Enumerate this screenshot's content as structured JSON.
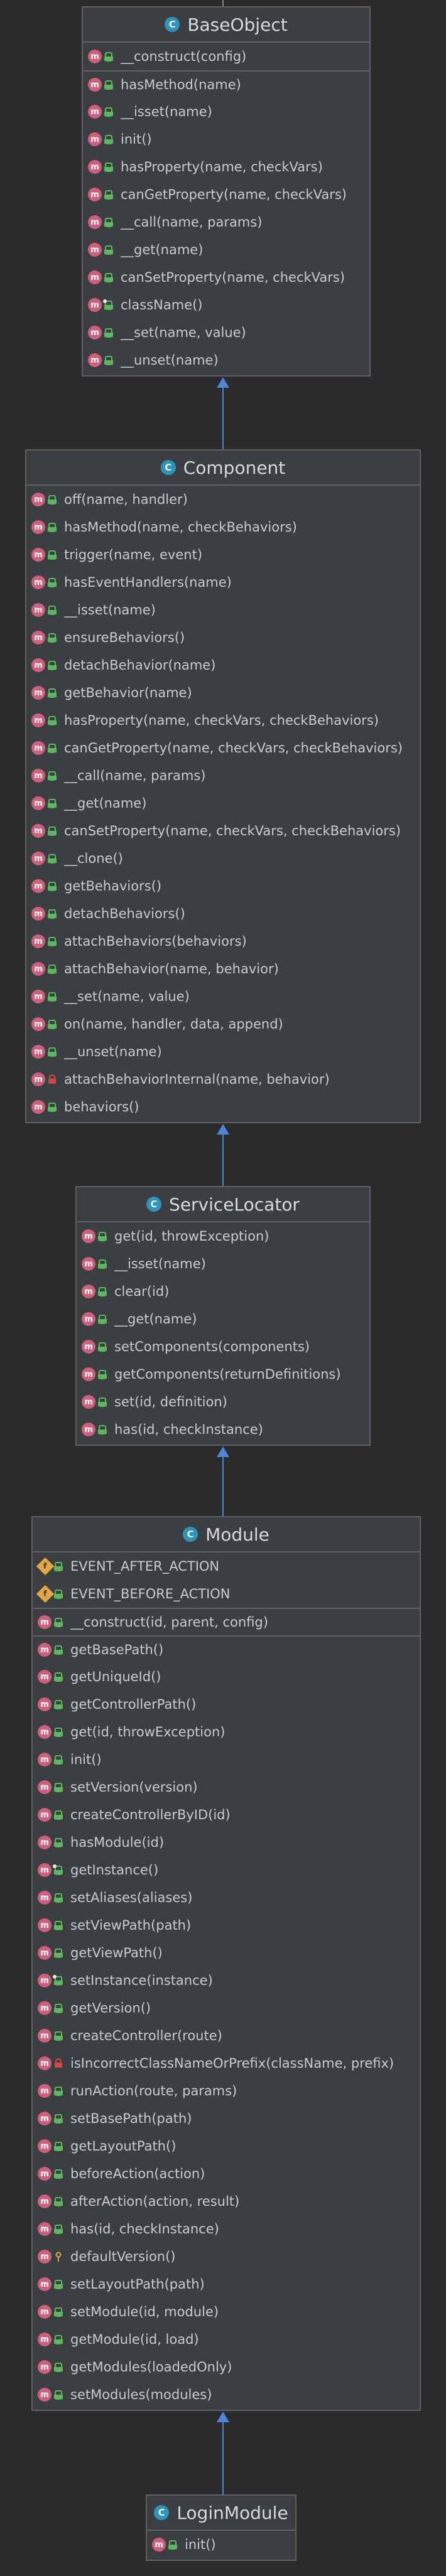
{
  "colors": {
    "background": "#2b2b2b",
    "box": "#3c3f41",
    "border": "#5e6163",
    "class_icon": "#2f94b8",
    "method_icon": "#d05f7b",
    "field_icon": "#e3a644",
    "public": "#5bb85d",
    "protected": "#e0a23e",
    "private": "#d04848",
    "arrow": "#4d86d6"
  },
  "icons": {
    "class": "C",
    "method": "m",
    "field": "f"
  },
  "classes": [
    {
      "name": "BaseObject",
      "rows": [
        {
          "kind": "method",
          "vis": "public",
          "label": "__construct(config)"
        },
        {
          "sep": true,
          "kind": "method",
          "vis": "public",
          "label": "hasMethod(name)"
        },
        {
          "kind": "method",
          "vis": "public",
          "label": "__isset(name)"
        },
        {
          "kind": "method",
          "vis": "public",
          "label": "init()"
        },
        {
          "kind": "method",
          "vis": "public",
          "label": "hasProperty(name, checkVars)"
        },
        {
          "kind": "method",
          "vis": "public",
          "label": "canGetProperty(name, checkVars)"
        },
        {
          "kind": "method",
          "vis": "public",
          "label": "__call(name, params)"
        },
        {
          "kind": "method",
          "vis": "public",
          "label": "__get(name)"
        },
        {
          "kind": "method",
          "vis": "public",
          "label": "canSetProperty(name, checkVars)"
        },
        {
          "kind": "method",
          "vis": "public",
          "static": true,
          "label": "className()"
        },
        {
          "kind": "method",
          "vis": "public",
          "label": "__set(name, value)"
        },
        {
          "kind": "method",
          "vis": "public",
          "label": "__unset(name)"
        }
      ]
    },
    {
      "name": "Component",
      "rows": [
        {
          "kind": "method",
          "vis": "public",
          "label": "off(name, handler)"
        },
        {
          "kind": "method",
          "vis": "public",
          "label": "hasMethod(name, checkBehaviors)"
        },
        {
          "kind": "method",
          "vis": "public",
          "label": "trigger(name, event)"
        },
        {
          "kind": "method",
          "vis": "public",
          "label": "hasEventHandlers(name)"
        },
        {
          "kind": "method",
          "vis": "public",
          "label": "__isset(name)"
        },
        {
          "kind": "method",
          "vis": "public",
          "label": "ensureBehaviors()"
        },
        {
          "kind": "method",
          "vis": "public",
          "label": "detachBehavior(name)"
        },
        {
          "kind": "method",
          "vis": "public",
          "label": "getBehavior(name)"
        },
        {
          "kind": "method",
          "vis": "public",
          "label": "hasProperty(name, checkVars, checkBehaviors)"
        },
        {
          "kind": "method",
          "vis": "public",
          "label": "canGetProperty(name, checkVars, checkBehaviors)"
        },
        {
          "kind": "method",
          "vis": "public",
          "label": "__call(name, params)"
        },
        {
          "kind": "method",
          "vis": "public",
          "label": "__get(name)"
        },
        {
          "kind": "method",
          "vis": "public",
          "label": "canSetProperty(name, checkVars, checkBehaviors)"
        },
        {
          "kind": "method",
          "vis": "public",
          "label": "__clone()"
        },
        {
          "kind": "method",
          "vis": "public",
          "label": "getBehaviors()"
        },
        {
          "kind": "method",
          "vis": "public",
          "label": "detachBehaviors()"
        },
        {
          "kind": "method",
          "vis": "public",
          "label": "attachBehaviors(behaviors)"
        },
        {
          "kind": "method",
          "vis": "public",
          "label": "attachBehavior(name, behavior)"
        },
        {
          "kind": "method",
          "vis": "public",
          "label": "__set(name, value)"
        },
        {
          "kind": "method",
          "vis": "public",
          "label": "on(name, handler, data, append)"
        },
        {
          "kind": "method",
          "vis": "public",
          "label": "__unset(name)"
        },
        {
          "kind": "method",
          "vis": "private",
          "label": "attachBehaviorInternal(name, behavior)"
        },
        {
          "kind": "method",
          "vis": "public",
          "label": "behaviors()"
        }
      ]
    },
    {
      "name": "ServiceLocator",
      "rows": [
        {
          "kind": "method",
          "vis": "public",
          "label": "get(id, throwException)"
        },
        {
          "kind": "method",
          "vis": "public",
          "label": "__isset(name)"
        },
        {
          "kind": "method",
          "vis": "public",
          "label": "clear(id)"
        },
        {
          "kind": "method",
          "vis": "public",
          "label": "__get(name)"
        },
        {
          "kind": "method",
          "vis": "public",
          "label": "setComponents(components)"
        },
        {
          "kind": "method",
          "vis": "public",
          "label": "getComponents(returnDefinitions)"
        },
        {
          "kind": "method",
          "vis": "public",
          "label": "set(id, definition)"
        },
        {
          "kind": "method",
          "vis": "public",
          "label": "has(id, checkInstance)"
        }
      ]
    },
    {
      "name": "Module",
      "rows": [
        {
          "kind": "field",
          "vis": "public",
          "label": "EVENT_AFTER_ACTION"
        },
        {
          "kind": "field",
          "vis": "public",
          "label": "EVENT_BEFORE_ACTION"
        },
        {
          "sep": true,
          "kind": "method",
          "vis": "public",
          "label": "__construct(id, parent, config)"
        },
        {
          "sep": true,
          "kind": "method",
          "vis": "public",
          "label": "getBasePath()"
        },
        {
          "kind": "method",
          "vis": "public",
          "label": "getUniqueId()"
        },
        {
          "kind": "method",
          "vis": "public",
          "label": "getControllerPath()"
        },
        {
          "kind": "method",
          "vis": "public",
          "label": "get(id, throwException)"
        },
        {
          "kind": "method",
          "vis": "public",
          "label": "init()"
        },
        {
          "kind": "method",
          "vis": "public",
          "label": "setVersion(version)"
        },
        {
          "kind": "method",
          "vis": "public",
          "label": "createControllerByID(id)"
        },
        {
          "kind": "method",
          "vis": "public",
          "label": "hasModule(id)"
        },
        {
          "kind": "method",
          "vis": "public",
          "static": true,
          "label": "getInstance()"
        },
        {
          "kind": "method",
          "vis": "public",
          "label": "setAliases(aliases)"
        },
        {
          "kind": "method",
          "vis": "public",
          "label": "setViewPath(path)"
        },
        {
          "kind": "method",
          "vis": "public",
          "label": "getViewPath()"
        },
        {
          "kind": "method",
          "vis": "public",
          "static": true,
          "label": "setInstance(instance)"
        },
        {
          "kind": "method",
          "vis": "public",
          "label": "getVersion()"
        },
        {
          "kind": "method",
          "vis": "public",
          "label": "createController(route)"
        },
        {
          "kind": "method",
          "vis": "private",
          "label": "isIncorrectClassNameOrPrefix(className, prefix)"
        },
        {
          "kind": "method",
          "vis": "public",
          "label": "runAction(route, params)"
        },
        {
          "kind": "method",
          "vis": "public",
          "label": "setBasePath(path)"
        },
        {
          "kind": "method",
          "vis": "public",
          "label": "getLayoutPath()"
        },
        {
          "kind": "method",
          "vis": "public",
          "label": "beforeAction(action)"
        },
        {
          "kind": "method",
          "vis": "public",
          "label": "afterAction(action, result)"
        },
        {
          "kind": "method",
          "vis": "public",
          "label": "has(id, checkInstance)"
        },
        {
          "kind": "method",
          "vis": "protected",
          "label": "defaultVersion()"
        },
        {
          "kind": "method",
          "vis": "public",
          "label": "setLayoutPath(path)"
        },
        {
          "kind": "method",
          "vis": "public",
          "label": "setModule(id, module)"
        },
        {
          "kind": "method",
          "vis": "public",
          "label": "getModule(id, load)"
        },
        {
          "kind": "method",
          "vis": "public",
          "label": "getModules(loadedOnly)"
        },
        {
          "kind": "method",
          "vis": "public",
          "label": "setModules(modules)"
        }
      ]
    },
    {
      "name": "LoginModule",
      "rows": [
        {
          "kind": "method",
          "vis": "public",
          "label": "init()"
        }
      ]
    }
  ]
}
